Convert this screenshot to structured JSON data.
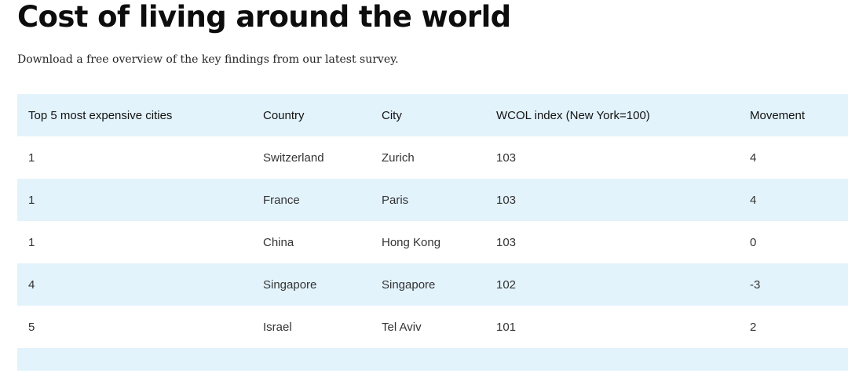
{
  "page": {
    "title": "Cost of living around the world",
    "intro": "Download a free overview of the key findings from our latest survey."
  },
  "table": {
    "headers": [
      "Top 5 most expensive cities",
      "Country",
      "City",
      "WCOL index (New York=100)",
      "Movement"
    ],
    "rows": [
      [
        "1",
        "Switzerland",
        "Zurich",
        "103",
        "4"
      ],
      [
        "1",
        "France",
        "Paris",
        "103",
        "4"
      ],
      [
        "1",
        "China",
        "Hong Kong",
        "103",
        "0"
      ],
      [
        "4",
        "Singapore",
        "Singapore",
        "102",
        "-3"
      ],
      [
        "5",
        "Israel",
        "Tel Aviv",
        "101",
        "2"
      ]
    ]
  },
  "colors": {
    "row_band": "#e3f3fc",
    "text": "#121212"
  }
}
